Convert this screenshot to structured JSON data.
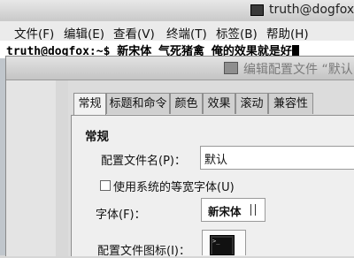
{
  "terminal": {
    "title": "truth@dogfox:",
    "menu": [
      {
        "label": "文件(F)"
      },
      {
        "label": "编辑(E)"
      },
      {
        "label": "查看(V)"
      },
      {
        "label": "终端(T)"
      },
      {
        "label": "标签(B)"
      },
      {
        "label": "帮助(H)"
      }
    ],
    "prompt": "truth@dogfox:~$ 新宋体 气死猪禽 俺的效果就是好"
  },
  "dialog": {
    "title": "编辑配置文件 “默认",
    "tabs": [
      {
        "label": "常规",
        "active": true
      },
      {
        "label": "标题和命令"
      },
      {
        "label": "颜色"
      },
      {
        "label": "效果"
      },
      {
        "label": "滚动"
      },
      {
        "label": "兼容性"
      }
    ],
    "section_title": "常规",
    "profile_name_label": "配置文件名(P)：",
    "profile_name_value": "默认",
    "use_system_mono_label": "使用系统的等宽字体(U)",
    "use_system_mono_checked": false,
    "font_label": "字体(F)：",
    "font_value": "新宋体",
    "profile_icon_label": "配置文件图标(I)："
  }
}
